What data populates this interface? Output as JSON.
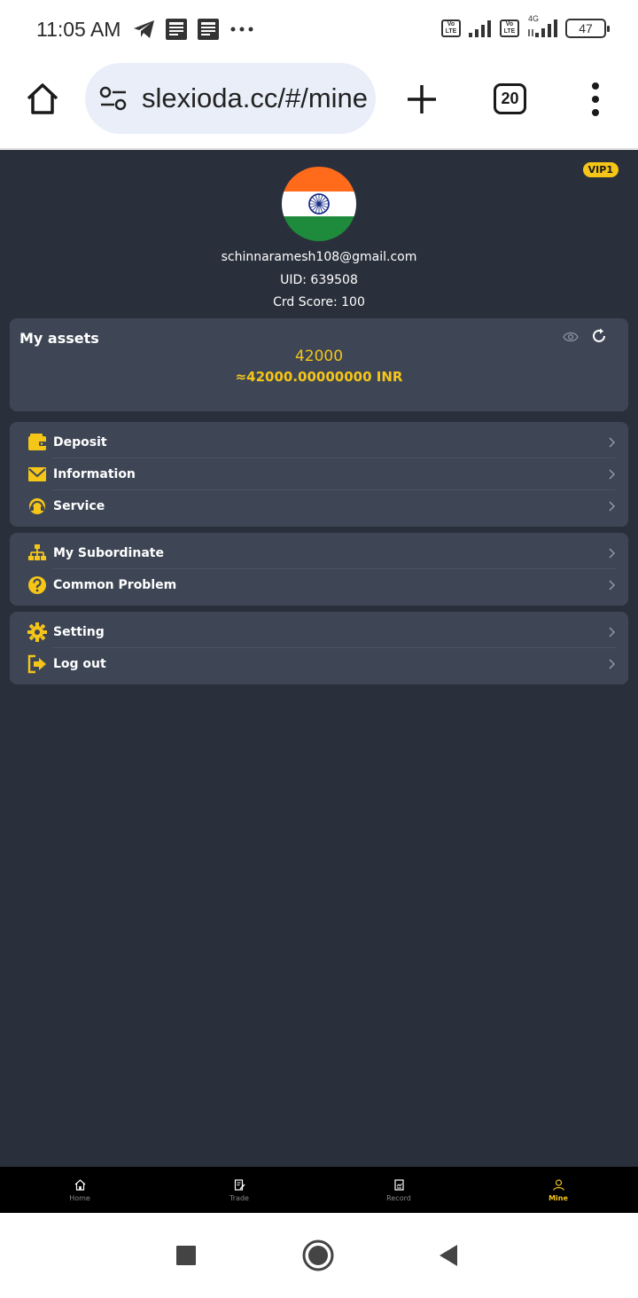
{
  "status_bar": {
    "time": "11:05 AM",
    "volte_labels": [
      "Vo",
      "LTE"
    ],
    "network_type": "4G",
    "battery": "47"
  },
  "browser": {
    "url": "slexioda.cc/#/mine",
    "tab_count": "20"
  },
  "profile": {
    "vip_badge": "VIP1",
    "email": "schinnaramesh108@gmail.com",
    "uid": "UID: 639508",
    "credit_score": "Crd Score: 100"
  },
  "assets": {
    "title": "My assets",
    "amount": "42000",
    "converted": "≈42000.00000000 INR"
  },
  "menu_groups": [
    [
      {
        "label": "Deposit",
        "icon": "wallet-icon"
      },
      {
        "label": "Information",
        "icon": "mail-icon"
      },
      {
        "label": "Service",
        "icon": "headset-icon"
      }
    ],
    [
      {
        "label": "My Subordinate",
        "icon": "hierarchy-icon"
      },
      {
        "label": "Common Problem",
        "icon": "question-icon"
      }
    ],
    [
      {
        "label": "Setting",
        "icon": "gear-icon"
      },
      {
        "label": "Log out",
        "icon": "logout-icon"
      }
    ]
  ],
  "bottom_nav": [
    {
      "label": "Home",
      "icon": "home-icon",
      "active": false
    },
    {
      "label": "Trade",
      "icon": "trade-icon",
      "active": false
    },
    {
      "label": "Record",
      "icon": "record-icon",
      "active": false
    },
    {
      "label": "Mine",
      "icon": "user-icon",
      "active": true
    }
  ],
  "colors": {
    "accent": "#f5c518",
    "background": "#2a303b",
    "card": "#3e4655"
  }
}
